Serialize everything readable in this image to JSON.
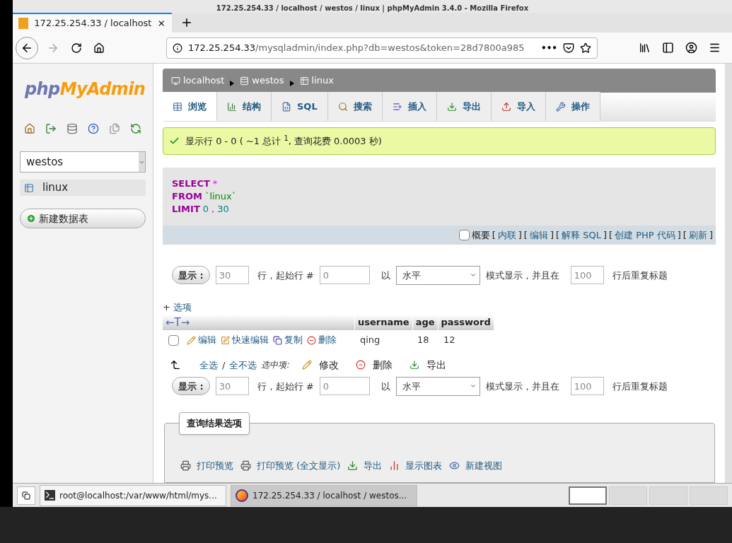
{
  "window": {
    "title": "172.25.254.33 / localhost / westos / linux | phpMyAdmin 3.4.0 - Mozilla Firefox"
  },
  "browser": {
    "tab_title": "172.25.254.33 / localhost",
    "url_host": "172.25.254.33",
    "url_path": "/mysqladmin/index.php?db=westos&token=28d7800a985",
    "more": "•••"
  },
  "sidebar": {
    "logo_php": "php",
    "logo_myadmin": "MyAdmin",
    "database": "westos",
    "tables": [
      {
        "name": "linux"
      }
    ],
    "new_table": "新建数据表"
  },
  "breadcrumb": [
    "localhost",
    "westos",
    "linux"
  ],
  "tabs": [
    {
      "label": "浏览",
      "selected": true
    },
    {
      "label": "结构",
      "selected": false
    },
    {
      "label": "SQL",
      "selected": false
    },
    {
      "label": "搜索",
      "selected": false
    },
    {
      "label": "插入",
      "selected": false
    },
    {
      "label": "导出",
      "selected": false
    },
    {
      "label": "导入",
      "selected": false
    },
    {
      "label": "操作",
      "selected": false
    }
  ],
  "message": "显示行 0 - 0 ( ~1 总计 $^{1}$, 查询花费 0.0003 秒)",
  "sql": [
    [
      {
        "kind": "keyword",
        "text": "SELECT"
      },
      {
        "kind": "operator",
        "text": "*"
      }
    ],
    [
      {
        "kind": "keyword",
        "text": "FROM"
      },
      {
        "kind": "identifier",
        "text": "`linux`"
      }
    ],
    [
      {
        "kind": "keyword",
        "text": "LIMIT"
      },
      {
        "kind": "number",
        "text": "0"
      },
      {
        "kind": "operator",
        "text": ","
      },
      {
        "kind": "number",
        "text": "30"
      }
    ]
  ],
  "sql_tools": {
    "bracket_open": "[",
    "bracket_close": "]",
    "profiling": {
      "label": "概要",
      "checked": false
    },
    "links": [
      "内联",
      "编辑",
      "解释 SQL",
      "创建 PHP 代码",
      "刷新"
    ]
  },
  "nav_forms": [
    {
      "button": "显示 :",
      "rows": "30",
      "rows_label": "行，起始行 #",
      "start": "0",
      "mode_prefix": "以",
      "mode": "水平",
      "mode_label": "模式显示，并且在",
      "repeat": "100",
      "repeat_label": "行后重复标题"
    },
    {
      "button": "显示 :",
      "rows": "30",
      "rows_label": "行，起始行 #",
      "start": "0",
      "mode_prefix": "以",
      "mode": "水平",
      "mode_label": "模式显示，并且在",
      "repeat": "100",
      "repeat_label": "行后重复标题"
    }
  ],
  "options": {
    "sign": "+",
    "label": "选项"
  },
  "table": {
    "arrows": "←T→",
    "columns": [
      "username",
      "age",
      "password"
    ],
    "rows": [
      {
        "checked": false,
        "actions": [
          "编辑",
          "快速编辑",
          "复制",
          "删除"
        ],
        "cells": [
          "qing",
          "18",
          "12"
        ]
      }
    ]
  },
  "bulk": {
    "check_all": "全选",
    "separator": "/",
    "uncheck_all": "全不选",
    "with_selected": "选中项:",
    "actions": [
      "修改",
      "删除",
      "导出"
    ]
  },
  "result_options": {
    "legend": "查询结果选项",
    "links": [
      "打印预览",
      "打印预览 (全文显示)",
      "导出",
      "显示图表",
      "新建视图"
    ]
  },
  "taskbar": {
    "windows": [
      {
        "title": "root@localhost:/var/www/html/mys...",
        "selected": false
      },
      {
        "title": "172.25.254.33 / localhost / westos...",
        "selected": true
      }
    ],
    "workspaces": [
      {
        "selected": true
      },
      {
        "selected": false
      },
      {
        "selected": false
      },
      {
        "selected": false
      }
    ]
  }
}
